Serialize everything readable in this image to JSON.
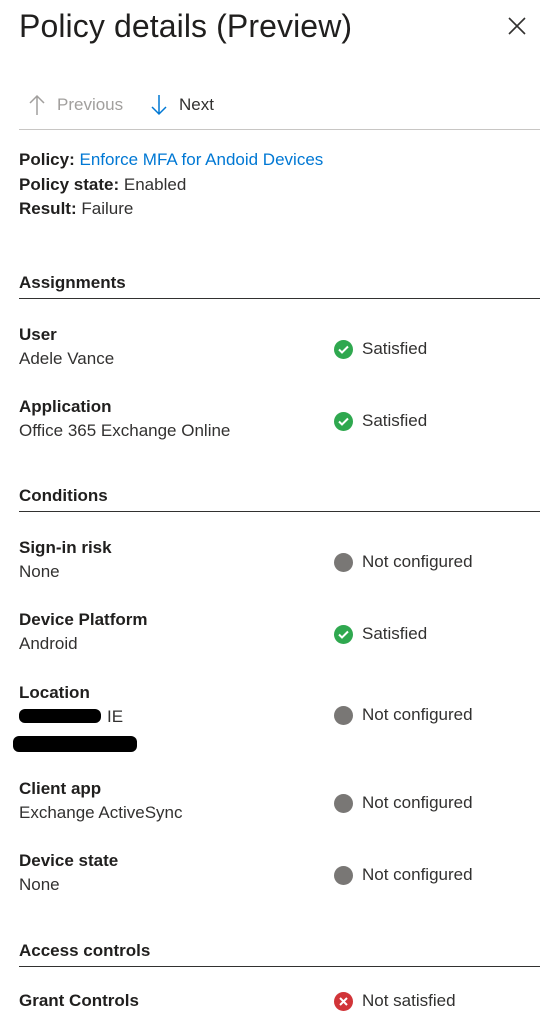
{
  "panel": {
    "title": "Policy details (Preview)",
    "close_icon": "close-icon"
  },
  "nav": {
    "previous_label": "Previous",
    "next_label": "Next"
  },
  "summary": {
    "policy_label": "Policy:",
    "policy_value": "Enforce MFA for Andoid Devices",
    "state_label": "Policy state:",
    "state_value": "Enabled",
    "result_label": "Result:",
    "result_value": "Failure"
  },
  "sections": {
    "assignments": "Assignments",
    "conditions": "Conditions",
    "access_controls": "Access controls"
  },
  "rows": {
    "user": {
      "label": "User",
      "value": "Adele Vance",
      "status": "Satisfied"
    },
    "application": {
      "label": "Application",
      "value": "Office 365 Exchange Online",
      "status": "Satisfied"
    },
    "signin_risk": {
      "label": "Sign-in risk",
      "value": "None",
      "status": "Not configured"
    },
    "device_platform": {
      "label": "Device Platform",
      "value": "Android",
      "status": "Satisfied"
    },
    "location": {
      "label": "Location",
      "value": "IE",
      "status": "Not configured"
    },
    "client_app": {
      "label": "Client app",
      "value": "Exchange ActiveSync",
      "status": "Not configured"
    },
    "device_state": {
      "label": "Device state",
      "value": "None",
      "status": "Not configured"
    },
    "grant_controls": {
      "label": "Grant Controls",
      "value": "",
      "status": "Not satisfied"
    }
  },
  "colors": {
    "accent": "#0078d4",
    "satisfied": "#2fa84f",
    "not_configured": "#797775",
    "not_satisfied": "#d13438"
  }
}
